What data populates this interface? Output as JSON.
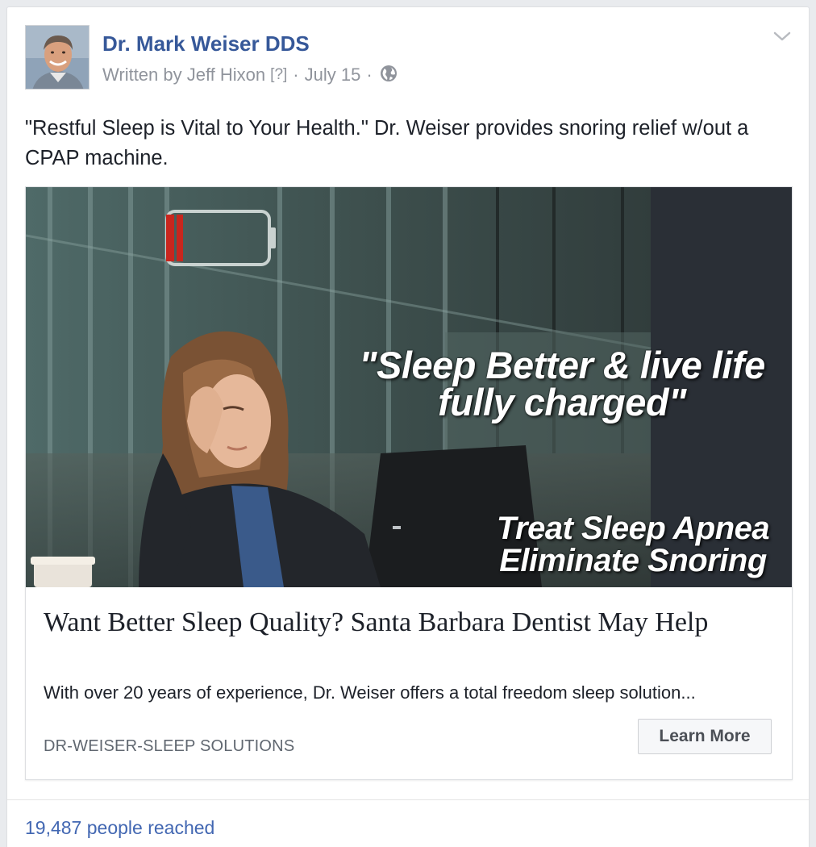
{
  "post": {
    "author_name": "Dr. Mark Weiser DDS",
    "written_by": "Written by Jeff Hixon",
    "help_marker": "[?]",
    "separator": "·",
    "date": "July 15",
    "audience_icon": "globe-icon",
    "menu_icon": "chevron-down-icon",
    "caption": "\"Restful Sleep is Vital to Your Health.\" Dr. Weiser provides snoring relief w/out a CPAP machine."
  },
  "link_preview": {
    "image": {
      "headline_line1": "\"Sleep Better & live life",
      "headline_line2": "fully charged\"",
      "sub_line1": "Treat Sleep Apnea",
      "sub_line2": "Eliminate Snoring"
    },
    "title": "Want Better Sleep Quality? Santa Barbara Dentist May Help",
    "description": "With over 20 years of experience, Dr. Weiser offers a total freedom sleep solution...",
    "domain": "DR-WEISER-SLEEP SOLUTIONS",
    "cta_label": "Learn More"
  },
  "footer": {
    "reach": "19,487 people reached"
  },
  "colors": {
    "link_blue": "#365899",
    "meta_gray": "#90949c",
    "reach_blue": "#4267b2",
    "battery_red": "#c8261e"
  }
}
